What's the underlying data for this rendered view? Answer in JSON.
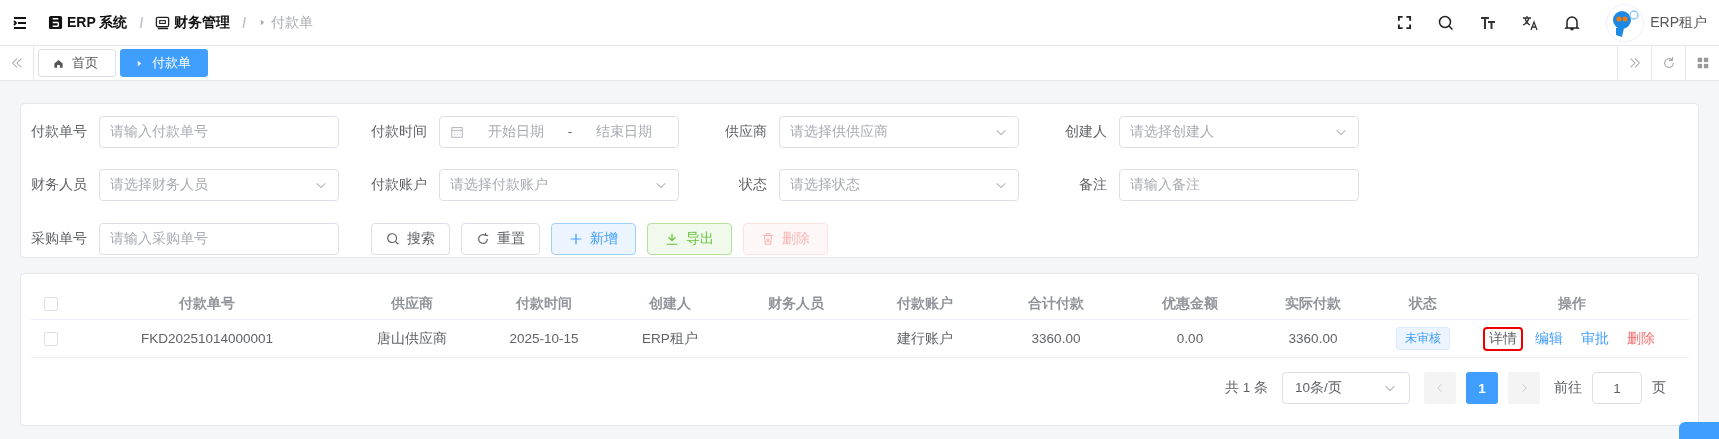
{
  "header": {
    "breadcrumb": [
      {
        "label": "ERP 系统"
      },
      {
        "label": "财务管理"
      },
      {
        "label": "付款单"
      }
    ],
    "separator": "/",
    "user": "ERP租户"
  },
  "tabs": [
    {
      "label": "首页",
      "selected": false
    },
    {
      "label": "付款单",
      "selected": true
    }
  ],
  "filters": [
    {
      "label": "付款单号",
      "kind": "input",
      "placeholder": "请输入付款单号"
    },
    {
      "label": "付款时间",
      "kind": "daterange",
      "start_placeholder": "开始日期",
      "separator": "-",
      "end_placeholder": "结束日期"
    },
    {
      "label": "供应商",
      "kind": "select",
      "placeholder": "请选择供供应商"
    },
    {
      "label": "创建人",
      "kind": "select",
      "placeholder": "请选择创建人"
    },
    {
      "label": "财务人员",
      "kind": "select",
      "placeholder": "请选择财务人员"
    },
    {
      "label": "付款账户",
      "kind": "select",
      "placeholder": "请选择付款账户"
    },
    {
      "label": "状态",
      "kind": "select",
      "placeholder": "请选择状态"
    },
    {
      "label": "备注",
      "kind": "input",
      "placeholder": "请输入备注"
    },
    {
      "label": "采购单号",
      "kind": "input",
      "placeholder": "请输入采购单号"
    }
  ],
  "buttons": [
    {
      "label": "搜索",
      "kind": "default",
      "disabled": false
    },
    {
      "label": "重置",
      "kind": "default",
      "disabled": false
    },
    {
      "label": "新增",
      "kind": "primary",
      "disabled": false
    },
    {
      "label": "导出",
      "kind": "success",
      "disabled": false
    },
    {
      "label": "删除",
      "kind": "danger",
      "disabled": true
    }
  ],
  "table": {
    "select_all": {
      "checked": false
    },
    "columns": [
      "付款单号",
      "供应商",
      "付款时间",
      "创建人",
      "财务人员",
      "付款账户",
      "合计付款",
      "优惠金额",
      "实际付款",
      "状态",
      "操作"
    ],
    "rows": [
      {
        "checked": false,
        "cells": [
          "FKD20251014000001",
          "唐山供应商",
          "2025-10-15",
          "ERP租户",
          "",
          "建行账户",
          "3360.00",
          "0.00",
          "3360.00"
        ],
        "status": "未审核",
        "actions": [
          {
            "label": "详情",
            "kind": "default",
            "highlighted": true
          },
          {
            "label": "编辑",
            "kind": "primary",
            "highlighted": false
          },
          {
            "label": "审批",
            "kind": "primary",
            "highlighted": false
          },
          {
            "label": "删除",
            "kind": "danger",
            "highlighted": false
          }
        ]
      }
    ]
  },
  "pagination": {
    "total": "共 1 条",
    "page_size": "10条/页",
    "pages": [
      {
        "label": "1",
        "selected": true
      }
    ],
    "goto_label": "前往",
    "goto_value": "1",
    "suffix": "页"
  }
}
